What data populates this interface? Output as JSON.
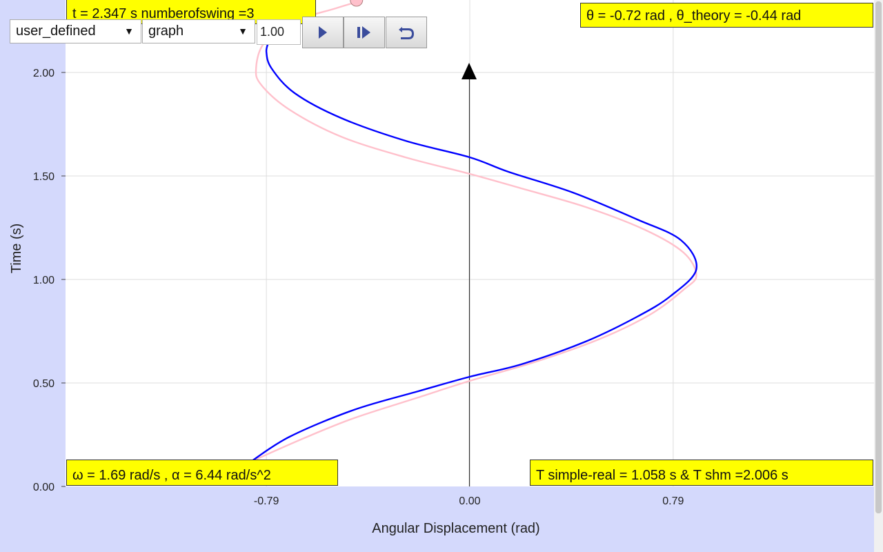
{
  "controls": {
    "mode_select": "user_defined",
    "view_select": "graph",
    "speed_value": "1.00",
    "arrow_glyph": "▼",
    "play_icon": "play-icon",
    "step_icon": "step-forward-icon",
    "reset_icon": "reset-icon"
  },
  "info": {
    "top_left": "t = 2.347 s numberofswing =3",
    "top_right": "θ = -0.72 rad , θ_theory = -0.44 rad",
    "bottom_left": "ω = 1.69 rad/s , α = 6.44 rad/s^2",
    "bottom_right": "T simple-real = 1.058 s & T shm =2.006 s"
  },
  "colors": {
    "background": "#d4d9fc",
    "simulated_line": "#0000ff",
    "theory_line": "#ffc0cb",
    "info_box": "#ffff00"
  },
  "chart_data": {
    "type": "line",
    "xlabel": "Angular Displacement (rad)",
    "ylabel": "Time (s)",
    "x_ticks": [
      "-0.79",
      "0.00",
      "0.79"
    ],
    "y_ticks": [
      "0.00",
      "0.50",
      "1.00",
      "1.50",
      "2.00"
    ],
    "xlim": [
      -1.57,
      1.57
    ],
    "ylim": [
      0,
      2.35
    ],
    "grid": true,
    "series": [
      {
        "color": "#0000ff",
        "points": [
          [
            -0.85,
            0.12
          ],
          [
            -0.7,
            0.24
          ],
          [
            -0.45,
            0.37
          ],
          [
            -0.2,
            0.46
          ],
          [
            0.0,
            0.53
          ],
          [
            0.2,
            0.59
          ],
          [
            0.45,
            0.7
          ],
          [
            0.65,
            0.82
          ],
          [
            0.78,
            0.92
          ],
          [
            0.88,
            1.05
          ],
          [
            0.82,
            1.19
          ],
          [
            0.65,
            1.29
          ],
          [
            0.4,
            1.42
          ],
          [
            0.15,
            1.52
          ],
          [
            0.0,
            1.59
          ],
          [
            -0.25,
            1.67
          ],
          [
            -0.5,
            1.78
          ],
          [
            -0.68,
            1.9
          ],
          [
            -0.77,
            2.02
          ],
          [
            -0.79,
            2.1
          ],
          [
            -0.78,
            2.15
          ]
        ]
      },
      {
        "color": "#ffc0cb",
        "points": [
          [
            -0.85,
            0.12
          ],
          [
            -0.65,
            0.23
          ],
          [
            -0.45,
            0.33
          ],
          [
            -0.2,
            0.43
          ],
          [
            0.0,
            0.51
          ],
          [
            0.25,
            0.6
          ],
          [
            0.5,
            0.71
          ],
          [
            0.7,
            0.83
          ],
          [
            0.83,
            0.95
          ],
          [
            0.88,
            1.02
          ],
          [
            0.83,
            1.13
          ],
          [
            0.68,
            1.24
          ],
          [
            0.45,
            1.35
          ],
          [
            0.2,
            1.44
          ],
          [
            0.0,
            1.51
          ],
          [
            -0.25,
            1.59
          ],
          [
            -0.5,
            1.69
          ],
          [
            -0.7,
            1.82
          ],
          [
            -0.81,
            1.94
          ],
          [
            -0.83,
            2.02
          ],
          [
            -0.8,
            2.14
          ],
          [
            -0.7,
            2.24
          ],
          [
            -0.52,
            2.31
          ],
          [
            -0.44,
            2.34
          ]
        ]
      }
    ],
    "current_point": {
      "x": -0.44,
      "y": 2.35,
      "color": "#ffc0cb"
    }
  }
}
